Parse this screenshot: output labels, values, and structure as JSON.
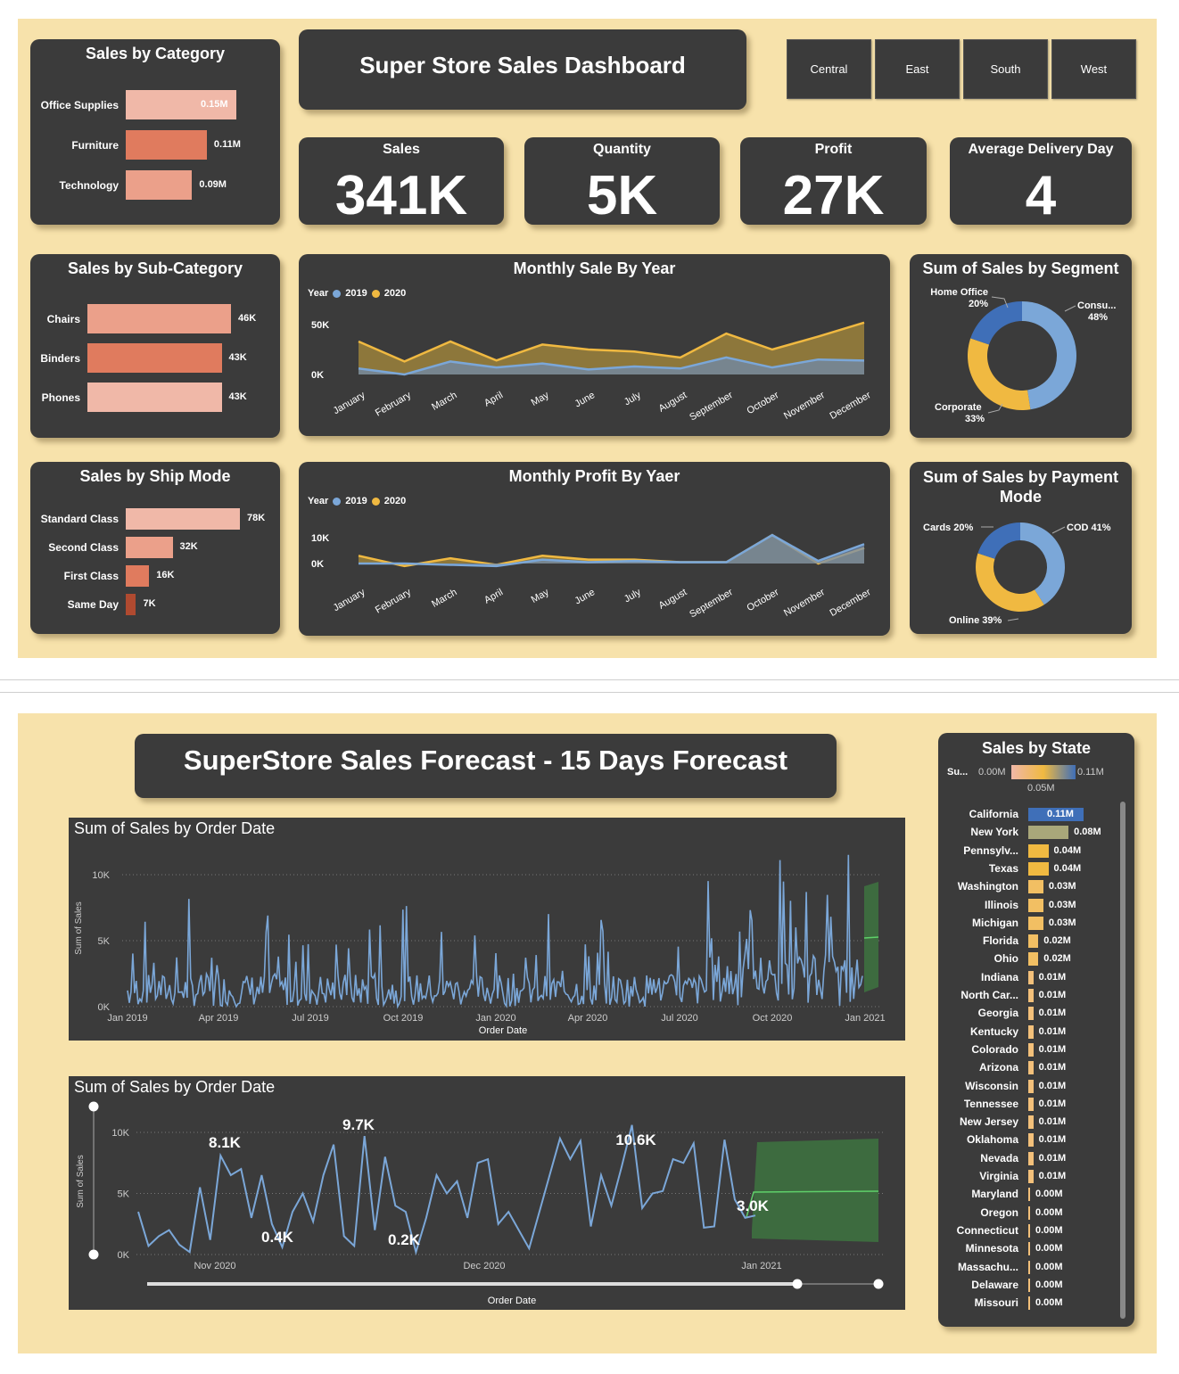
{
  "page1": {
    "title": "Super Store Sales Dashboard",
    "regions": [
      "Central",
      "East",
      "South",
      "West"
    ],
    "kpis": [
      {
        "label": "Sales",
        "value": "341K"
      },
      {
        "label": "Quantity",
        "value": "5K"
      },
      {
        "label": "Profit",
        "value": "27K"
      },
      {
        "label": "Average Delivery Day",
        "value": "4"
      }
    ],
    "sales_by_category": {
      "title": "Sales by Category",
      "items": [
        {
          "label": "Office Supplies",
          "value": "0.15M",
          "num": 0.15,
          "color": "#f0b8a8"
        },
        {
          "label": "Furniture",
          "value": "0.11M",
          "num": 0.11,
          "color": "#e07b5e"
        },
        {
          "label": "Technology",
          "value": "0.09M",
          "num": 0.09,
          "color": "#eba08a"
        }
      ]
    },
    "sales_by_subcategory": {
      "title": "Sales by Sub-Category",
      "items": [
        {
          "label": "Chairs",
          "value": "46K",
          "num": 46,
          "color": "#eba08a"
        },
        {
          "label": "Binders",
          "value": "43K",
          "num": 43,
          "color": "#e07b5e"
        },
        {
          "label": "Phones",
          "value": "43K",
          "num": 43,
          "color": "#f0b8a8"
        }
      ]
    },
    "sales_by_shipmode": {
      "title": "Sales by Ship Mode",
      "items": [
        {
          "label": "Standard Class",
          "value": "78K",
          "num": 78,
          "color": "#f0b8a8"
        },
        {
          "label": "Second Class",
          "value": "32K",
          "num": 32,
          "color": "#eba08a"
        },
        {
          "label": "First Class",
          "value": "16K",
          "num": 16,
          "color": "#e07b5e"
        },
        {
          "label": "Same Day",
          "value": "7K",
          "num": 7,
          "color": "#b04a30"
        }
      ]
    },
    "monthly_sale": {
      "title": "Monthly Sale By Year",
      "legend_title": "Year",
      "series_names": [
        "2019",
        "2020"
      ],
      "colors": {
        "2019": "#7ba7d8",
        "2020": "#f0b941"
      },
      "y_ticks": [
        "50K",
        "0K"
      ],
      "months": [
        "January",
        "February",
        "March",
        "April",
        "May",
        "June",
        "July",
        "August",
        "September",
        "October",
        "November",
        "December"
      ]
    },
    "monthly_profit": {
      "title": "Monthly Profit By Yaer",
      "legend_title": "Year",
      "series_names": [
        "2019",
        "2020"
      ],
      "y_ticks": [
        "10K",
        "0K"
      ],
      "months": [
        "January",
        "February",
        "March",
        "April",
        "May",
        "June",
        "July",
        "August",
        "September",
        "October",
        "November",
        "December"
      ]
    },
    "segment": {
      "title": "Sum of Sales by Segment",
      "slices": [
        {
          "label": "Consu...",
          "pct": "48%",
          "value": 48,
          "color": "#7ba7d8"
        },
        {
          "label": "Corporate",
          "pct": "33%",
          "value": 33,
          "color": "#f0b941"
        },
        {
          "label": "Home Office",
          "pct": "20%",
          "value": 20,
          "color": "#3f6fb8"
        }
      ]
    },
    "payment": {
      "title": "Sum of Sales by Payment Mode",
      "slices": [
        {
          "label": "COD 41%",
          "value": 41,
          "color": "#7ba7d8"
        },
        {
          "label": "Online 39%",
          "value": 39,
          "color": "#f0b941"
        },
        {
          "label": "Cards 20%",
          "value": 20,
          "color": "#3f6fb8"
        }
      ]
    }
  },
  "page2": {
    "title": "SuperStore Sales Forecast - 15 Days Forecast",
    "chart1": {
      "title": "Sum of Sales by Order Date",
      "ylabel": "Sum of Sales",
      "xlabel": "Order Date",
      "y_ticks": [
        "10K",
        "5K",
        "0K"
      ],
      "x_ticks": [
        "Jan 2019",
        "Apr 2019",
        "Jul 2019",
        "Oct 2019",
        "Jan 2020",
        "Apr 2020",
        "Jul 2020",
        "Oct 2020",
        "Jan 2021"
      ]
    },
    "chart2": {
      "title": "Sum of Sales by Order Date",
      "ylabel": "Sum of Sales",
      "xlabel": "Order Date",
      "y_ticks": [
        "10K",
        "5K",
        "0K"
      ],
      "x_ticks": [
        "Nov 2020",
        "Dec 2020",
        "Jan 2021"
      ],
      "annotations": [
        "8.1K",
        "9.7K",
        "10.6K",
        "0.4K",
        "0.2K",
        "3.0K"
      ]
    },
    "states": {
      "title": "Sales by State",
      "legend_label": "Su...",
      "legend_min": "0.00M",
      "legend_mid": "0.05M",
      "legend_max": "0.11M",
      "items": [
        {
          "label": "California",
          "value": "0.11M",
          "num": 0.11
        },
        {
          "label": "New York",
          "value": "0.08M",
          "num": 0.08
        },
        {
          "label": "Pennsylv...",
          "value": "0.04M",
          "num": 0.04
        },
        {
          "label": "Texas",
          "value": "0.04M",
          "num": 0.04
        },
        {
          "label": "Washington",
          "value": "0.03M",
          "num": 0.03
        },
        {
          "label": "Illinois",
          "value": "0.03M",
          "num": 0.03
        },
        {
          "label": "Michigan",
          "value": "0.03M",
          "num": 0.03
        },
        {
          "label": "Florida",
          "value": "0.02M",
          "num": 0.02
        },
        {
          "label": "Ohio",
          "value": "0.02M",
          "num": 0.02
        },
        {
          "label": "Indiana",
          "value": "0.01M",
          "num": 0.01
        },
        {
          "label": "North Car...",
          "value": "0.01M",
          "num": 0.01
        },
        {
          "label": "Georgia",
          "value": "0.01M",
          "num": 0.01
        },
        {
          "label": "Kentucky",
          "value": "0.01M",
          "num": 0.01
        },
        {
          "label": "Colorado",
          "value": "0.01M",
          "num": 0.01
        },
        {
          "label": "Arizona",
          "value": "0.01M",
          "num": 0.01
        },
        {
          "label": "Wisconsin",
          "value": "0.01M",
          "num": 0.01
        },
        {
          "label": "Tennessee",
          "value": "0.01M",
          "num": 0.01
        },
        {
          "label": "New Jersey",
          "value": "0.01M",
          "num": 0.01
        },
        {
          "label": "Oklahoma",
          "value": "0.01M",
          "num": 0.01
        },
        {
          "label": "Nevada",
          "value": "0.01M",
          "num": 0.01
        },
        {
          "label": "Virginia",
          "value": "0.01M",
          "num": 0.01
        },
        {
          "label": "Maryland",
          "value": "0.00M",
          "num": 0.0
        },
        {
          "label": "Oregon",
          "value": "0.00M",
          "num": 0.0
        },
        {
          "label": "Connecticut",
          "value": "0.00M",
          "num": 0.0
        },
        {
          "label": "Minnesota",
          "value": "0.00M",
          "num": 0.0
        },
        {
          "label": "Massachu...",
          "value": "0.00M",
          "num": 0.0
        },
        {
          "label": "Delaware",
          "value": "0.00M",
          "num": 0.0
        },
        {
          "label": "Missouri",
          "value": "0.00M",
          "num": 0.0
        }
      ]
    }
  },
  "colors": {
    "background": "#f7e2ab",
    "card": "#3b3b3b",
    "blue": "#7ba7d8",
    "gold": "#f0b941",
    "forecast": "#3d6b3f"
  }
}
